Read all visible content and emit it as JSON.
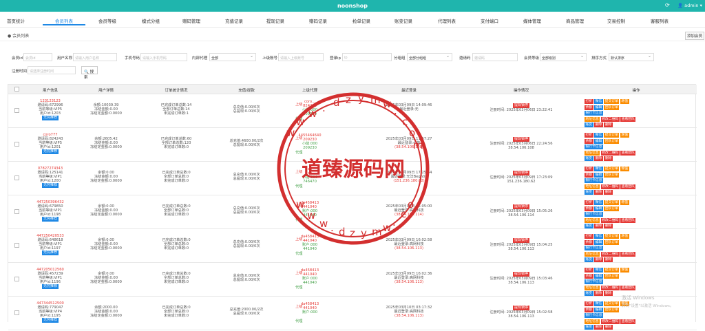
{
  "app": {
    "title": "noonshop",
    "user": "admin"
  },
  "nav": [
    "首页统计",
    "会员列表",
    "会员等级",
    "模式分组",
    "赠码管理",
    "充值记录",
    "提现记录",
    "赠码记录",
    "抢单记录",
    "账变记录",
    "代理列表",
    "支付端口",
    "媒体管理",
    "商品管理",
    "交易控制",
    "客服列表"
  ],
  "breadcrumb": "会员列表",
  "add_button": "添加会员",
  "filters": {
    "member_id": {
      "label": "会员id",
      "placeholder": "会员id"
    },
    "username": {
      "label": "用户名称",
      "placeholder": "请输入用户名称"
    },
    "phone": {
      "label": "手机号码",
      "placeholder": "请输入手机号码"
    },
    "internal": {
      "label": "内部代理",
      "value": "全部"
    },
    "superior": {
      "label": "上级账号",
      "placeholder": "请输入上级账号"
    },
    "login_ip": {
      "label": "登录ip",
      "placeholder": "ip"
    },
    "group": {
      "label": "分组组",
      "value": "全部分组组"
    },
    "invite": {
      "label": "邀请码",
      "placeholder": "邀请码"
    },
    "level": {
      "label": "会员等级",
      "value": "全部级别"
    },
    "sort": {
      "label": "排序方式",
      "value": "默认排序"
    },
    "reg_time": {
      "label": "注册时间",
      "placeholder": "请选择注册时间"
    },
    "search_button": "搜 索"
  },
  "columns": [
    "用户信息",
    "用户详情",
    "订单统计情况",
    "充值/提款",
    "上级代理",
    "最近登录",
    "操作情况",
    "操作"
  ],
  "buttons": {
    "r1": [
      "打折",
      "微信",
      "提交订单",
      "增值"
    ],
    "r2": [
      "余额",
      "编辑",
      "团队订单",
      "银行卡信息"
    ],
    "r3": [
      "地址信息",
      "修改二维码",
      "查看团队"
    ],
    "r4": [
      "账变",
      "删除",
      "删除"
    ]
  },
  "rows": [
    {
      "id": "123123123",
      "invite": "邀请码:672996",
      "level": "当前等级:VIP5",
      "uid": "用户id:1203",
      "status": "无穷推荐",
      "detail": [
        "余额:10039.39",
        "冻结金额:0.00",
        "冻结定金额:0.0000"
      ],
      "orders": [
        "已完成订单总数:14",
        "全部订单总数:14",
        "未完成订单数:1"
      ],
      "money": [
        "总充值:0.00/0次",
        "总提现:0.00/0次"
      ],
      "sup_state": "上级",
      "proxy": [
        "coro...",
        "824243",
        "小能:000",
        "209230"
      ],
      "proxy_state": "代理",
      "login": [
        "2025年03月09日 14:09:46",
        "最近登录:无"
      ],
      "op_status": "提现锁停",
      "op_time": "注册时间: 2025年03月06日 23:22:41"
    },
    {
      "id": "coro777",
      "invite": "邀请码:824243",
      "level": "当前等级:VIP5",
      "uid": "用户id:1201",
      "status": "无穷推荐",
      "detail": [
        "余额:2605.42",
        "冻结金额:0.00",
        "冻结定金额:0.0000"
      ],
      "orders": [
        "已完成订单总数:60",
        "全部订单总数:120",
        "未完成订单数:0"
      ],
      "money": [
        "总充值:4600.00/2次",
        "总提现:0.00/0次"
      ],
      "sup_state": "上级",
      "proxy": [
        "4455464640",
        "209230",
        "小能:000",
        "209230"
      ],
      "proxy_state": "代理",
      "login": [
        "2025年03月09日 11:57:27",
        "最近登录:小能",
        "(38.54.106.108)"
      ],
      "op_status": "提现锁停",
      "op_time": "注册时间: 2025年03月06日 22:24:56",
      "op_ip": "38.54.106.108"
    },
    {
      "id": "07827274343",
      "invite": "邀请码:125141",
      "level": "当前等级:VIP1",
      "uid": "用户id:1200",
      "status": "无穷推荐",
      "detail": [
        "余额:0.00",
        "冻结金额:0.00",
        "冻结定金额:0.0000"
      ],
      "orders": [
        "已完成订单总数:0",
        "全部订单总数:0",
        "未完成订单数:0"
      ],
      "money": [
        "总充值:0.00/0次",
        "总提现:0.00/0次"
      ],
      "sup_state": "上级",
      "proxy": [
        "ab",
        "ab",
        "小能:000",
        "746470"
      ],
      "proxy_state": "代理",
      "login": [
        "2025年03月09日 17:25:44",
        "最近登录:无法Beghtill",
        "(151.236.180.62)"
      ],
      "op_status": "提现锁停",
      "op_time": "注册时间: 2025年03月09日 17:23:09",
      "op_ip": "151.236.180.62"
    },
    {
      "id": "447250396432",
      "invite": "邀请码:679850",
      "level": "当前等级:VIP1",
      "uid": "用户id:1198",
      "status": "无穷推荐",
      "detail": [
        "余额:0.00",
        "冻结金额:0.00",
        "冻结定金额:0.0000"
      ],
      "orders": [
        "已完成订单总数:0",
        "全部订单总数:0",
        "未完成订单数:0"
      ],
      "money": [
        "总充值:0.00/0次",
        "总提现:0.00/0次"
      ],
      "sup_state": "上级",
      "proxy": [
        "da458413",
        "441040",
        "账户:000",
        "441040"
      ],
      "proxy_state": "代理",
      "login": [
        "2025年03月09日 15:05:00",
        "最近登录:高网科技",
        "(38.54.106.114)"
      ],
      "op_status": "提现锁停",
      "op_time": "注册时间: 2025年03月09日 15:05:26",
      "op_ip": "38.54.106.114"
    },
    {
      "id": "447250420533",
      "invite": "邀请码:648618",
      "level": "当前等级:VIP1",
      "uid": "用户id:1197",
      "status": "无穷推荐",
      "detail": [
        "余额:0.00",
        "冻结金额:0.00",
        "冻结定金额:0.0000"
      ],
      "orders": [
        "已完成订单总数:0",
        "全部订单总数:0",
        "未完成订单数:0"
      ],
      "money": [
        "总充值:0.00/0次",
        "总提现:0.00/0次"
      ],
      "sup_state": "上级",
      "proxy": [
        "da458413",
        "441040",
        "账户:000",
        "441040"
      ],
      "proxy_state": "代理",
      "login": [
        "2025年03月09日 16:02:58",
        "最近登录:高网科技",
        "(38.54.106.113)"
      ],
      "op_status": "提现锁停",
      "op_time": "注册时间: 2025年03月09日 15:04:25",
      "op_ip": "38.54.106.113"
    },
    {
      "id": "447205012560",
      "invite": "邀请码:457239",
      "level": "当前等级:VIP1",
      "uid": "用户id:1196",
      "status": "无穷推荐",
      "detail": [
        "余额:0.00",
        "冻结金额:0.00",
        "冻结定金额:0.0000"
      ],
      "orders": [
        "已完成订单总数:0",
        "全部订单总数:0",
        "未完成订单数:0"
      ],
      "money": [
        "总充值:0.00/0次",
        "总提现:0.00/0次"
      ],
      "sup_state": "上级",
      "proxy": [
        "da458413",
        "441040",
        "账户:000",
        "441040"
      ],
      "proxy_state": "代理",
      "login": [
        "2025年03月09日 16:02:36",
        "最近登录:高网科技",
        "(38.54.106.113)"
      ],
      "op_status": "提现锁停",
      "op_time": "注册时间: 2025年03月09日 15:03:46",
      "op_ip": "38.54.106.113"
    },
    {
      "id": "447344512500",
      "invite": "邀请码:779047",
      "level": "当前等级:VIP4",
      "uid": "用户id:1195",
      "status": "无穷推荐",
      "detail": [
        "余额:2000.00",
        "冻结金额:0.00",
        "冻结定金额:0.0000"
      ],
      "orders": [
        "已完成订单总数:0",
        "全部订单总数:0",
        "未完成订单数:0"
      ],
      "money": [
        "总充值:2000.00/2次",
        "总提现:0.00/0次"
      ],
      "sup_state": "上级",
      "proxy": [
        "da458413",
        "441040",
        "账户:000"
      ],
      "proxy_state": "代理",
      "login": [
        "2025年03月10日 03:17:32",
        "最近登录:高网科技",
        "(38.54.106.113)"
      ],
      "op_status": "提现锁停",
      "op_time": "注册时间: 2025年03月09日 15:02:58",
      "op_ip": "38.54.106.113"
    }
  ],
  "watermark": {
    "text": "道臻源码网",
    "url": "www.dzymw.com"
  },
  "windows": {
    "line1": "激活 Windows",
    "line2": "转到\"设置\"以激活 Windows。"
  }
}
